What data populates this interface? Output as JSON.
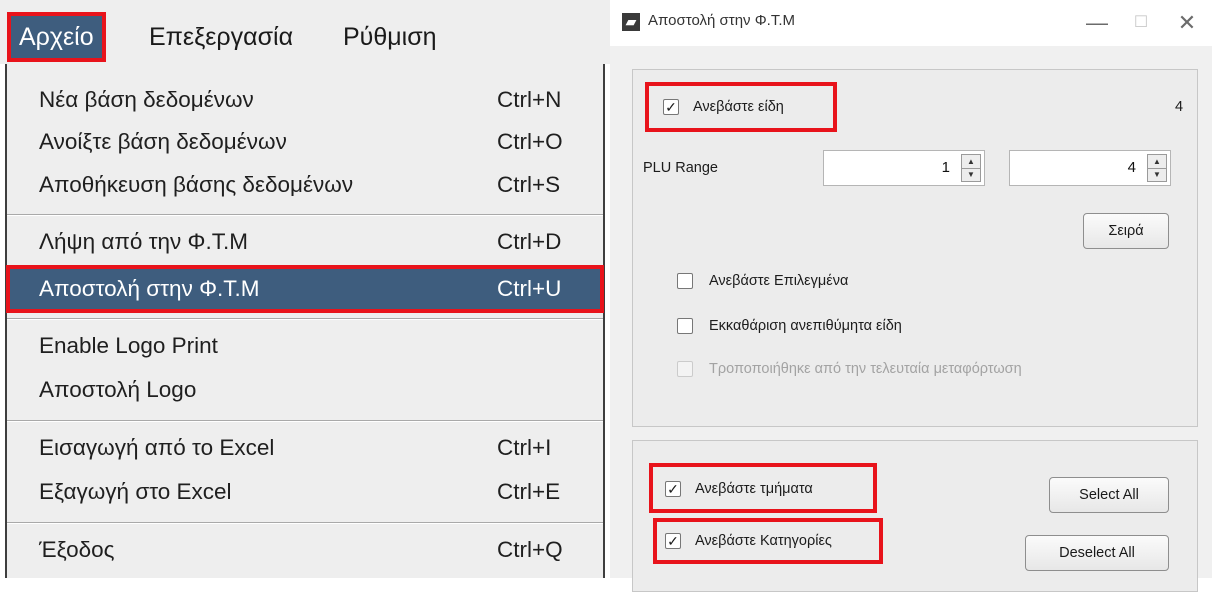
{
  "menubar": {
    "menus": [
      {
        "label": "Αρχείο"
      },
      {
        "label": "Επεξεργασία"
      },
      {
        "label": "Ρύθμιση"
      }
    ]
  },
  "file_menu": {
    "items": [
      {
        "label": "Νέα βάση δεδομένων",
        "shortcut": "Ctrl+N"
      },
      {
        "label": "Ανοίξτε βάση δεδομένων",
        "shortcut": "Ctrl+O"
      },
      {
        "label": "Αποθήκευση βάσης δεδομένων",
        "shortcut": "Ctrl+S"
      },
      {
        "label": "Λήψη από την Φ.Τ.Μ",
        "shortcut": "Ctrl+D"
      },
      {
        "label": "Αποστολή στην Φ.Τ.Μ",
        "shortcut": "Ctrl+U"
      },
      {
        "label": "Enable Logo Print",
        "shortcut": ""
      },
      {
        "label": "Αποστολή Logo",
        "shortcut": ""
      },
      {
        "label": "Εισαγωγή από το Excel",
        "shortcut": "Ctrl+I"
      },
      {
        "label": "Εξαγωγή στο Excel",
        "shortcut": "Ctrl+E"
      },
      {
        "label": "Έξοδος",
        "shortcut": "Ctrl+Q"
      }
    ]
  },
  "dialog": {
    "title": "Αποστολή στην Φ.Τ.Μ",
    "window_buttons": {
      "minimize": "—",
      "maximize": "☐",
      "close": "✕"
    },
    "upload_items": {
      "label": "Ανεβάστε είδη",
      "checked": true,
      "count": "4"
    },
    "plu_range": {
      "label": "PLU Range",
      "from": "1",
      "to": "4"
    },
    "order_button": "Σειρά",
    "options": [
      {
        "label": "Ανεβάστε Επιλεγμένα",
        "checked": false,
        "enabled": true
      },
      {
        "label": "Εκκαθάριση ανεπιθύμητα είδη",
        "checked": false,
        "enabled": true
      },
      {
        "label": "Τροποποιήθηκε από την τελευταία μεταφόρτωση",
        "checked": false,
        "enabled": false
      }
    ],
    "upload_departments": {
      "label": "Ανεβάστε τμήματα",
      "checked": true
    },
    "upload_categories": {
      "label": "Ανεβάστε Κατηγορίες",
      "checked": true
    },
    "select_all": "Select All",
    "deselect_all": "Deselect All",
    "check_glyph": "✓"
  },
  "colors": {
    "selection": "#3e5d7e",
    "highlight": "#e8131b"
  }
}
